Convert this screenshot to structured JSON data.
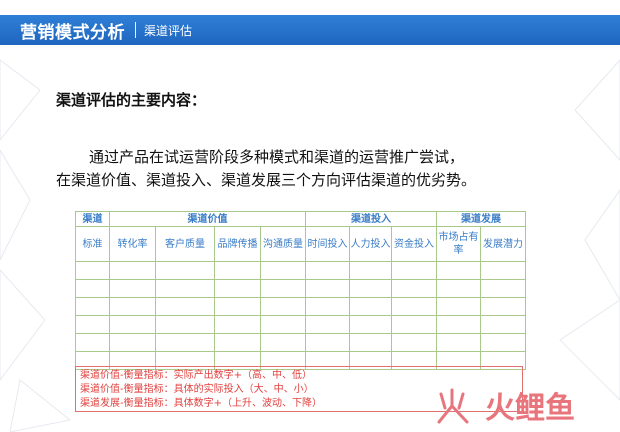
{
  "header": {
    "title": "营销模式分析",
    "subtitle": "渠道评估"
  },
  "heading": "渠道评估的主要内容：",
  "paragraph": {
    "line1": "通过产品在试运营阶段多种模式和渠道的运营推广尝试，",
    "line2": "在渠道价值、渠道投入、渠道发展三个方向评估渠道的优劣势。"
  },
  "table": {
    "groups": [
      "渠道",
      "渠道价值",
      "渠道投入",
      "渠道发展"
    ],
    "columns": [
      "标准",
      "转化率",
      "客户质量",
      "品牌传播",
      "沟通质量",
      "时间投入",
      "人力投入",
      "资金投入",
      "市场占有率",
      "发展潜力"
    ],
    "empty_rows": 6
  },
  "notes": [
    "渠道价值-衡量指标：实际产出数字+（高、中、低）",
    "渠道价值-衡量指标：具体的实际投入（大、中、小）",
    "渠道发展-衡量指标：具体数字+（上升、波动、下降）"
  ],
  "logo": {
    "text": "火鲤鱼"
  },
  "colors": {
    "header": "#1f66bf",
    "table_text": "#3a7dc8",
    "table_border": "#a9c98b",
    "note": "#e0403e",
    "logo": "#e8747c"
  }
}
